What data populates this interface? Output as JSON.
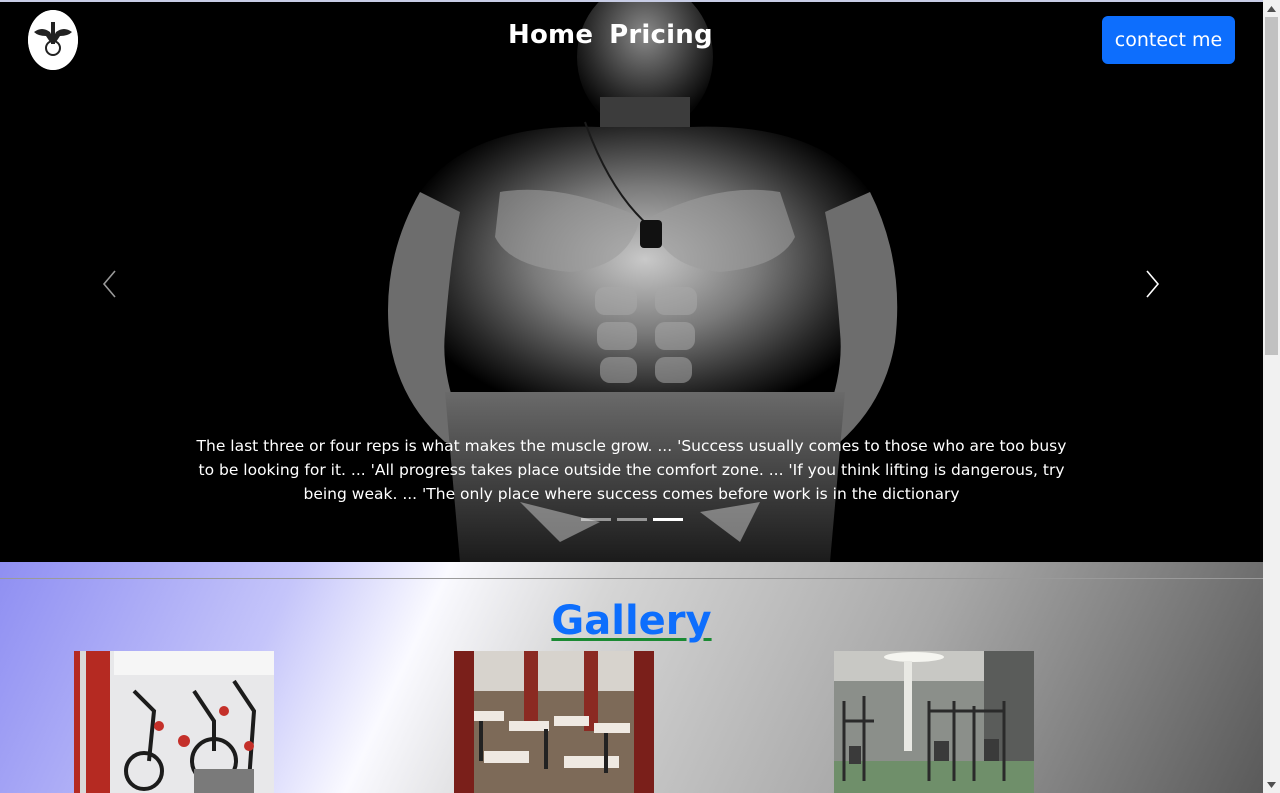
{
  "navbar": {
    "logo_icon": "fitness-logo-icon",
    "links": [
      "Home",
      "Pricing"
    ],
    "contact_label": "contect me",
    "contact_color": "#0d6efd"
  },
  "carousel": {
    "caption": "The last three or four reps is what makes the muscle grow. ... 'Success usually comes to those who are too busy to be looking for it. ... 'All progress takes place outside the comfort zone. ... 'If you think lifting is dangerous, try being weak. ... 'The only place where success comes before work is in the dictionary",
    "prev_icon": "chevron-left-icon",
    "next_icon": "chevron-right-icon",
    "slide_count": 3,
    "active_slide": 3
  },
  "gallery": {
    "title": "Gallery",
    "title_color": "#0d6efd",
    "images": [
      "gym-bikes-photo",
      "gym-weights-room-photo",
      "gym-machines-photo"
    ]
  }
}
